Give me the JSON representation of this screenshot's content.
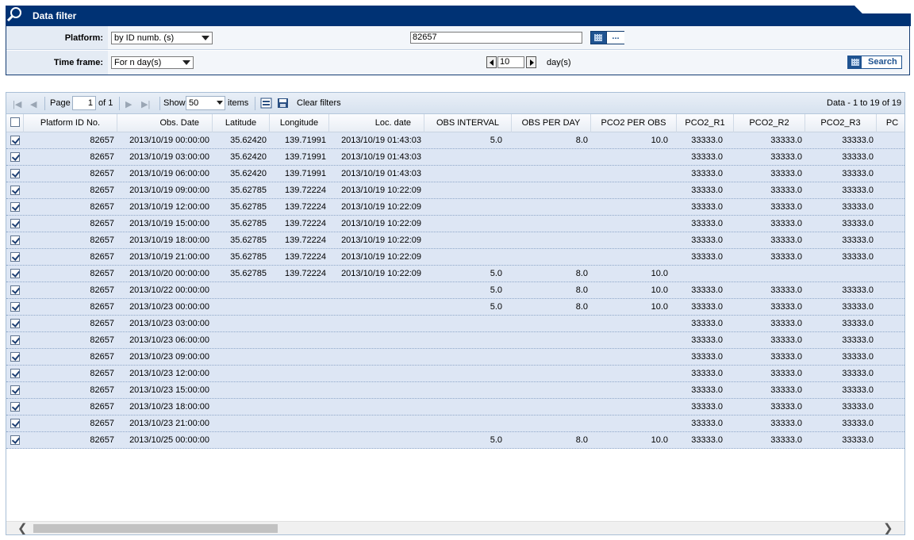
{
  "filter": {
    "title": "Data filter",
    "platform_label": "Platform:",
    "platform_select": "by ID numb. (s)",
    "platform_value": "82657",
    "browse_label": "...",
    "timeframe_label": "Time frame:",
    "timeframe_select": "For n day(s)",
    "days_value": "10",
    "days_unit": "day(s)",
    "search_label": "Search"
  },
  "toolbar": {
    "page_label": "Page",
    "page_value": "1",
    "of_label": "of 1",
    "show_label": "Show",
    "show_value": "50",
    "items_label": "items",
    "clear_filters": "Clear filters",
    "data_summary": "Data - 1 to 19 of 19"
  },
  "columns": [
    "Platform ID No.",
    "Obs. Date",
    "Latitude",
    "Longitude",
    "Loc. date",
    "OBS INTERVAL",
    "OBS PER DAY",
    "PCO2 PER OBS",
    "PCO2_R1",
    "PCO2_R2",
    "PCO2_R3",
    "PC"
  ],
  "rows": [
    {
      "id": "82657",
      "date": "2013/10/19 00:00:00",
      "lat": "35.62420",
      "lon": "139.71991",
      "loc": "2013/10/19 01:43:03",
      "oi": "5.0",
      "opd": "8.0",
      "ppo": "10.0",
      "r1": "33333.0",
      "r2": "33333.0",
      "r3": "33333.0"
    },
    {
      "id": "82657",
      "date": "2013/10/19 03:00:00",
      "lat": "35.62420",
      "lon": "139.71991",
      "loc": "2013/10/19 01:43:03",
      "oi": "",
      "opd": "",
      "ppo": "",
      "r1": "33333.0",
      "r2": "33333.0",
      "r3": "33333.0"
    },
    {
      "id": "82657",
      "date": "2013/10/19 06:00:00",
      "lat": "35.62420",
      "lon": "139.71991",
      "loc": "2013/10/19 01:43:03",
      "oi": "",
      "opd": "",
      "ppo": "",
      "r1": "33333.0",
      "r2": "33333.0",
      "r3": "33333.0"
    },
    {
      "id": "82657",
      "date": "2013/10/19 09:00:00",
      "lat": "35.62785",
      "lon": "139.72224",
      "loc": "2013/10/19 10:22:09",
      "oi": "",
      "opd": "",
      "ppo": "",
      "r1": "33333.0",
      "r2": "33333.0",
      "r3": "33333.0"
    },
    {
      "id": "82657",
      "date": "2013/10/19 12:00:00",
      "lat": "35.62785",
      "lon": "139.72224",
      "loc": "2013/10/19 10:22:09",
      "oi": "",
      "opd": "",
      "ppo": "",
      "r1": "33333.0",
      "r2": "33333.0",
      "r3": "33333.0"
    },
    {
      "id": "82657",
      "date": "2013/10/19 15:00:00",
      "lat": "35.62785",
      "lon": "139.72224",
      "loc": "2013/10/19 10:22:09",
      "oi": "",
      "opd": "",
      "ppo": "",
      "r1": "33333.0",
      "r2": "33333.0",
      "r3": "33333.0"
    },
    {
      "id": "82657",
      "date": "2013/10/19 18:00:00",
      "lat": "35.62785",
      "lon": "139.72224",
      "loc": "2013/10/19 10:22:09",
      "oi": "",
      "opd": "",
      "ppo": "",
      "r1": "33333.0",
      "r2": "33333.0",
      "r3": "33333.0"
    },
    {
      "id": "82657",
      "date": "2013/10/19 21:00:00",
      "lat": "35.62785",
      "lon": "139.72224",
      "loc": "2013/10/19 10:22:09",
      "oi": "",
      "opd": "",
      "ppo": "",
      "r1": "33333.0",
      "r2": "33333.0",
      "r3": "33333.0"
    },
    {
      "id": "82657",
      "date": "2013/10/20 00:00:00",
      "lat": "35.62785",
      "lon": "139.72224",
      "loc": "2013/10/19 10:22:09",
      "oi": "5.0",
      "opd": "8.0",
      "ppo": "10.0",
      "r1": "",
      "r2": "",
      "r3": ""
    },
    {
      "id": "82657",
      "date": "2013/10/22 00:00:00",
      "lat": "",
      "lon": "",
      "loc": "",
      "oi": "5.0",
      "opd": "8.0",
      "ppo": "10.0",
      "r1": "33333.0",
      "r2": "33333.0",
      "r3": "33333.0"
    },
    {
      "id": "82657",
      "date": "2013/10/23 00:00:00",
      "lat": "",
      "lon": "",
      "loc": "",
      "oi": "5.0",
      "opd": "8.0",
      "ppo": "10.0",
      "r1": "33333.0",
      "r2": "33333.0",
      "r3": "33333.0"
    },
    {
      "id": "82657",
      "date": "2013/10/23 03:00:00",
      "lat": "",
      "lon": "",
      "loc": "",
      "oi": "",
      "opd": "",
      "ppo": "",
      "r1": "33333.0",
      "r2": "33333.0",
      "r3": "33333.0"
    },
    {
      "id": "82657",
      "date": "2013/10/23 06:00:00",
      "lat": "",
      "lon": "",
      "loc": "",
      "oi": "",
      "opd": "",
      "ppo": "",
      "r1": "33333.0",
      "r2": "33333.0",
      "r3": "33333.0"
    },
    {
      "id": "82657",
      "date": "2013/10/23 09:00:00",
      "lat": "",
      "lon": "",
      "loc": "",
      "oi": "",
      "opd": "",
      "ppo": "",
      "r1": "33333.0",
      "r2": "33333.0",
      "r3": "33333.0"
    },
    {
      "id": "82657",
      "date": "2013/10/23 12:00:00",
      "lat": "",
      "lon": "",
      "loc": "",
      "oi": "",
      "opd": "",
      "ppo": "",
      "r1": "33333.0",
      "r2": "33333.0",
      "r3": "33333.0"
    },
    {
      "id": "82657",
      "date": "2013/10/23 15:00:00",
      "lat": "",
      "lon": "",
      "loc": "",
      "oi": "",
      "opd": "",
      "ppo": "",
      "r1": "33333.0",
      "r2": "33333.0",
      "r3": "33333.0"
    },
    {
      "id": "82657",
      "date": "2013/10/23 18:00:00",
      "lat": "",
      "lon": "",
      "loc": "",
      "oi": "",
      "opd": "",
      "ppo": "",
      "r1": "33333.0",
      "r2": "33333.0",
      "r3": "33333.0"
    },
    {
      "id": "82657",
      "date": "2013/10/23 21:00:00",
      "lat": "",
      "lon": "",
      "loc": "",
      "oi": "",
      "opd": "",
      "ppo": "",
      "r1": "33333.0",
      "r2": "33333.0",
      "r3": "33333.0"
    },
    {
      "id": "82657",
      "date": "2013/10/25 00:00:00",
      "lat": "",
      "lon": "",
      "loc": "",
      "oi": "5.0",
      "opd": "8.0",
      "ppo": "10.0",
      "r1": "33333.0",
      "r2": "33333.0",
      "r3": "33333.0"
    }
  ],
  "colors": {
    "header_blue": "#003274",
    "row_bg": "#dde6f4",
    "button_blue": "#1f5391"
  },
  "icons": [
    "magnifier-icon",
    "grid-icon",
    "first-page-icon",
    "prev-page-icon",
    "next-page-icon",
    "last-page-icon",
    "export-icon",
    "save-icon",
    "scroll-left-icon",
    "scroll-right-icon"
  ]
}
